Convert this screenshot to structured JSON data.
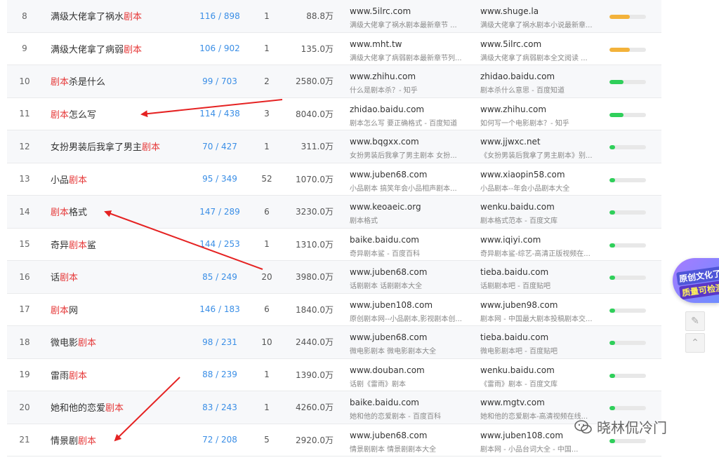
{
  "rows": [
    {
      "rank": "8",
      "kw_pre": "满级大佬拿了祸水",
      "kw_hl": "剧本",
      "kw_post": "",
      "index": "116 / 898",
      "count": "1",
      "volume": "88.8万",
      "site1": {
        "domain": "www.5ilrc.com",
        "desc": "满级大佬拿了祸水剧本最新章节 ..."
      },
      "site2": {
        "domain": "www.shuge.la",
        "desc": "满级大佬拿了祸水剧本小说最新章..."
      },
      "bar": {
        "level": 0.55,
        "color": "#f3b23a"
      }
    },
    {
      "rank": "9",
      "kw_pre": "满级大佬拿了病弱",
      "kw_hl": "剧本",
      "kw_post": "",
      "index": "106 / 902",
      "count": "1",
      "volume": "135.0万",
      "site1": {
        "domain": "www.mht.tw",
        "desc": "满级大佬拿了病弱剧本最新章节列..."
      },
      "site2": {
        "domain": "www.5ilrc.com",
        "desc": "满级大佬拿了病弱剧本全文阅读 ..."
      },
      "bar": {
        "level": 0.55,
        "color": "#f3b23a"
      }
    },
    {
      "rank": "10",
      "kw_pre": "",
      "kw_hl": "剧本",
      "kw_post": "杀是什么",
      "index": "99 / 703",
      "count": "2",
      "volume": "2580.0万",
      "site1": {
        "domain": "www.zhihu.com",
        "desc": "什么是剧本杀？- 知乎"
      },
      "site2": {
        "domain": "zhidao.baidu.com",
        "desc": "剧本杀什么意思 - 百度知道"
      },
      "bar": {
        "level": 0.38,
        "color": "#2fcf5a"
      }
    },
    {
      "rank": "11",
      "kw_pre": "",
      "kw_hl": "剧本",
      "kw_post": "怎么写",
      "index": "114 / 438",
      "count": "3",
      "volume": "8040.0万",
      "site1": {
        "domain": "zhidao.baidu.com",
        "desc": "剧本怎么写 要正确格式 - 百度知道"
      },
      "site2": {
        "domain": "www.zhihu.com",
        "desc": "如何写一个电影剧本？- 知乎"
      },
      "bar": {
        "level": 0.38,
        "color": "#2fcf5a"
      }
    },
    {
      "rank": "12",
      "kw_pre": "女扮男装后我拿了男主",
      "kw_hl": "剧本",
      "kw_post": "",
      "index": "70 / 427",
      "count": "1",
      "volume": "311.0万",
      "site1": {
        "domain": "www.bqgxx.com",
        "desc": "女扮男装后我拿了男主剧本 女扮..."
      },
      "site2": {
        "domain": "www.jjwxc.net",
        "desc": "《女扮男装后我拿了男主剧本》别..."
      },
      "bar": {
        "level": 0.16,
        "color": "#2fcf5a"
      }
    },
    {
      "rank": "13",
      "kw_pre": "小品",
      "kw_hl": "剧本",
      "kw_post": "",
      "index": "95 / 349",
      "count": "52",
      "volume": "1070.0万",
      "site1": {
        "domain": "www.juben68.com",
        "desc": "小品剧本 搞笑年会小品相声剧本..."
      },
      "site2": {
        "domain": "www.xiaopin58.com",
        "desc": "小品剧本--年会小品剧本大全"
      },
      "bar": {
        "level": 0.16,
        "color": "#2fcf5a"
      }
    },
    {
      "rank": "14",
      "kw_pre": "",
      "kw_hl": "剧本",
      "kw_post": "格式",
      "index": "147 / 289",
      "count": "6",
      "volume": "3230.0万",
      "site1": {
        "domain": "www.keoaeic.org",
        "desc": "剧本格式"
      },
      "site2": {
        "domain": "wenku.baidu.com",
        "desc": "剧本格式范本 - 百度文库"
      },
      "bar": {
        "level": 0.16,
        "color": "#2fcf5a"
      }
    },
    {
      "rank": "15",
      "kw_pre": "奇异",
      "kw_hl": "剧本",
      "kw_post": "鲨",
      "index": "144 / 253",
      "count": "1",
      "volume": "1310.0万",
      "site1": {
        "domain": "baike.baidu.com",
        "desc": "奇异剧本鲨 - 百度百科"
      },
      "site2": {
        "domain": "www.iqiyi.com",
        "desc": "奇异剧本鲨-综艺-高清正版视频在..."
      },
      "bar": {
        "level": 0.16,
        "color": "#2fcf5a"
      }
    },
    {
      "rank": "16",
      "kw_pre": "话",
      "kw_hl": "剧本",
      "kw_post": "",
      "index": "85 / 249",
      "count": "20",
      "volume": "3980.0万",
      "site1": {
        "domain": "www.juben68.com",
        "desc": "话剧剧本 话剧剧本大全"
      },
      "site2": {
        "domain": "tieba.baidu.com",
        "desc": "话剧剧本吧 - 百度贴吧"
      },
      "bar": {
        "level": 0.16,
        "color": "#2fcf5a"
      }
    },
    {
      "rank": "17",
      "kw_pre": "",
      "kw_hl": "剧本",
      "kw_post": "网",
      "index": "146 / 183",
      "count": "6",
      "volume": "1840.0万",
      "site1": {
        "domain": "www.juben108.com",
        "desc": "原创剧本网--小品剧本,影视剧本创..."
      },
      "site2": {
        "domain": "www.juben98.com",
        "desc": "剧本网 - 中国最大剧本投稿剧本交..."
      },
      "bar": {
        "level": 0.16,
        "color": "#2fcf5a"
      }
    },
    {
      "rank": "18",
      "kw_pre": "微电影",
      "kw_hl": "剧本",
      "kw_post": "",
      "index": "98 / 231",
      "count": "10",
      "volume": "2440.0万",
      "site1": {
        "domain": "www.juben68.com",
        "desc": "微电影剧本 微电影剧本大全"
      },
      "site2": {
        "domain": "tieba.baidu.com",
        "desc": "微电影剧本吧 - 百度贴吧"
      },
      "bar": {
        "level": 0.16,
        "color": "#2fcf5a"
      }
    },
    {
      "rank": "19",
      "kw_pre": "雷雨",
      "kw_hl": "剧本",
      "kw_post": "",
      "index": "88 / 239",
      "count": "1",
      "volume": "1390.0万",
      "site1": {
        "domain": "www.douban.com",
        "desc": "话剧《雷雨》剧本"
      },
      "site2": {
        "domain": "wenku.baidu.com",
        "desc": "《雷雨》剧本 - 百度文库"
      },
      "bar": {
        "level": 0.16,
        "color": "#2fcf5a"
      }
    },
    {
      "rank": "20",
      "kw_pre": "她和他的恋爱",
      "kw_hl": "剧本",
      "kw_post": "",
      "index": "83 / 243",
      "count": "1",
      "volume": "4260.0万",
      "site1": {
        "domain": "baike.baidu.com",
        "desc": "她和他的恋爱剧本 - 百度百科"
      },
      "site2": {
        "domain": "www.mgtv.com",
        "desc": "她和他的恋爱剧本-高清视频在线..."
      },
      "bar": {
        "level": 0.16,
        "color": "#2fcf5a"
      }
    },
    {
      "rank": "21",
      "kw_pre": "情景剧",
      "kw_hl": "剧本",
      "kw_post": "",
      "index": "72 / 208",
      "count": "5",
      "volume": "2920.0万",
      "site1": {
        "domain": "www.juben68.com",
        "desc": "情景剧剧本 情景剧剧本大全"
      },
      "site2": {
        "domain": "www.juben108.com",
        "desc": "剧本网 - 小品台词大全 - 中国..."
      },
      "bar": {
        "level": 0.16,
        "color": "#2fcf5a"
      }
    }
  ],
  "side_badge": {
    "line1": "原创文化了",
    "line2": "质量可检测"
  },
  "tools": {
    "edit_icon": "pencil-icon",
    "up_icon": "chevron-up-icon"
  },
  "watermark": {
    "text": "晓林侃冷门",
    "icon": "wechat-icon"
  },
  "colors": {
    "highlight": "#e63a3a",
    "link": "#3a8ee6",
    "arrow": "#e52222"
  }
}
